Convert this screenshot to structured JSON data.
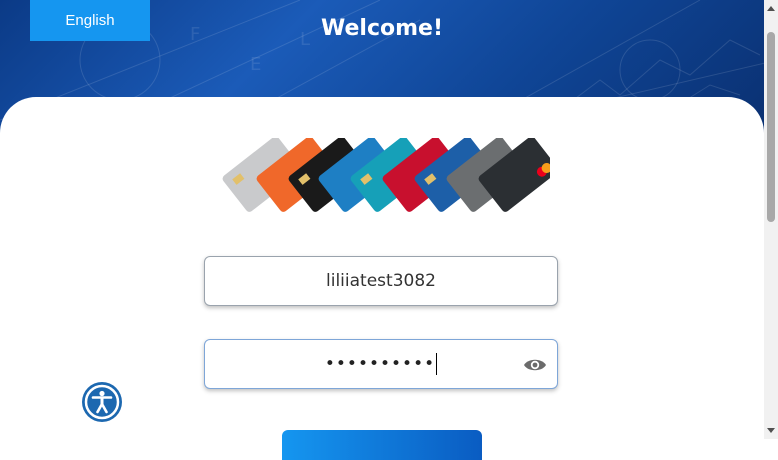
{
  "header": {
    "language_label": "English",
    "title": "Welcome!"
  },
  "login": {
    "username_value": "liliiatest3082",
    "password_masked": "••••••••••"
  },
  "icons": {
    "password_toggle": "eye-icon",
    "accessibility": "accessibility-icon"
  },
  "colors": {
    "brand_blue": "#1596f0",
    "header_dark": "#0b3a86",
    "accessibility_blue": "#1c68b0"
  }
}
